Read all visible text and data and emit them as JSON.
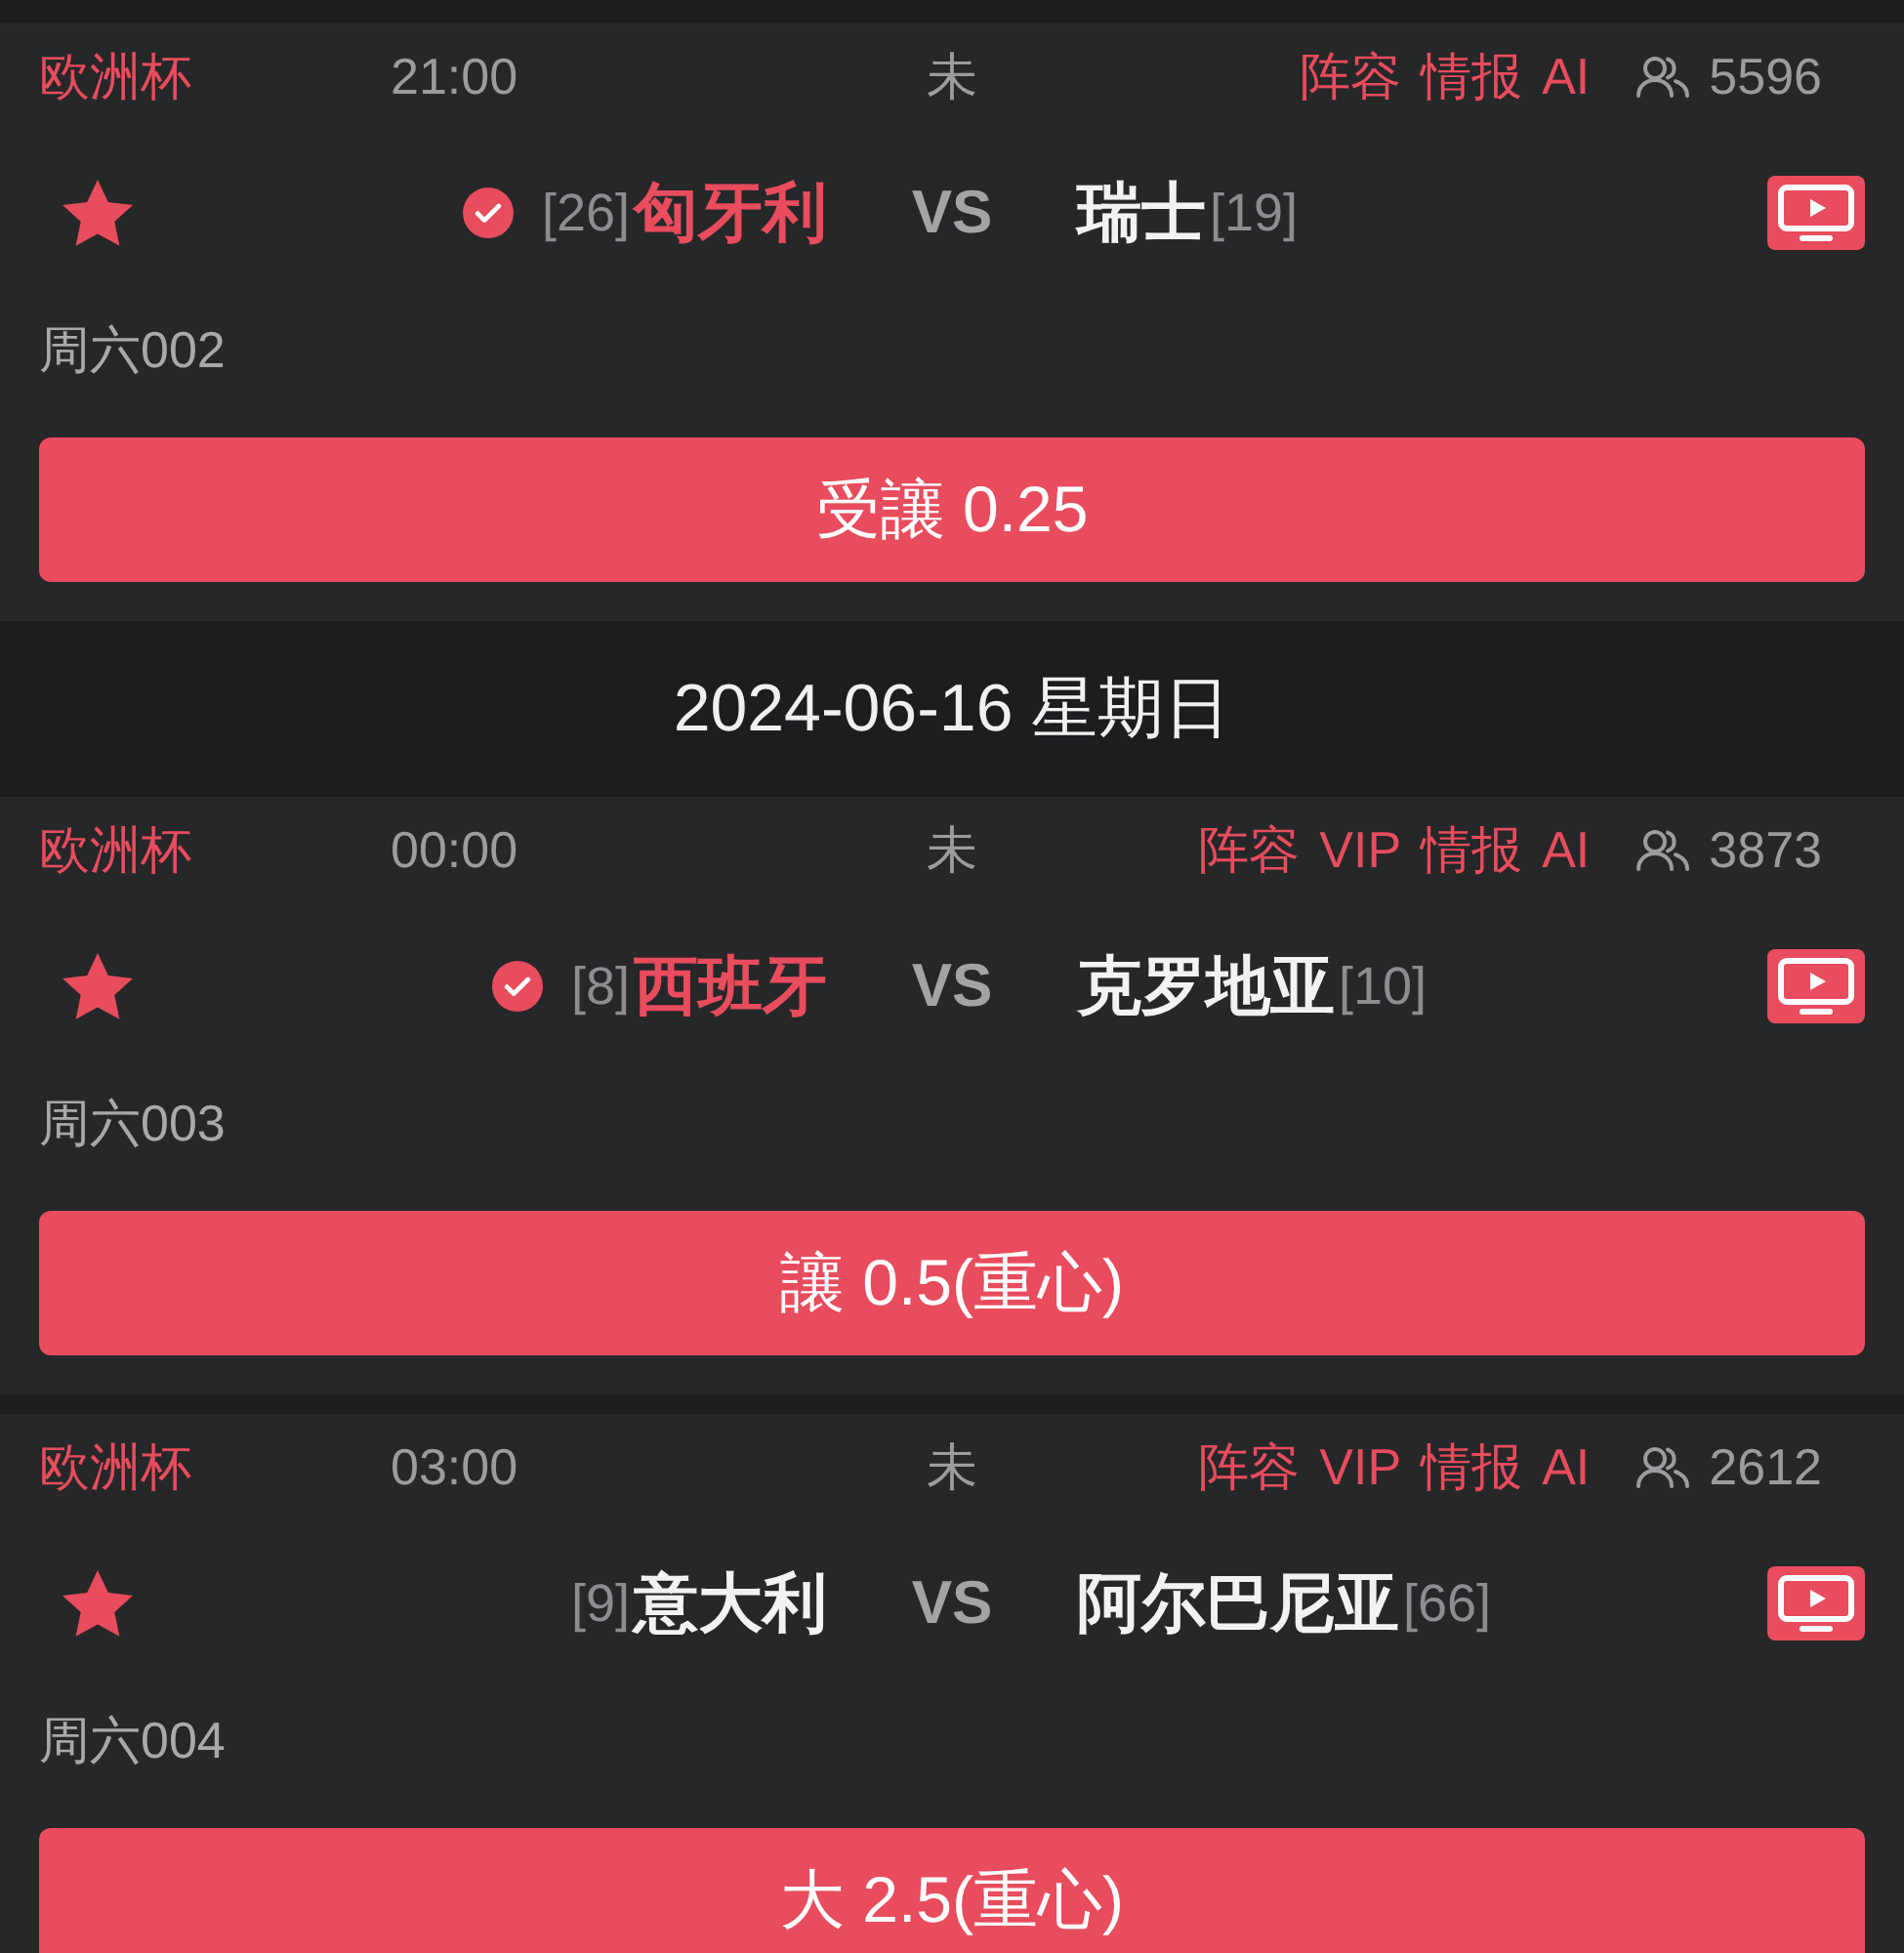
{
  "items": [
    {
      "kind": "match",
      "league": "欧洲杯",
      "time": "21:00",
      "status": "未",
      "tags": [
        "阵容",
        "情报",
        "AI"
      ],
      "viewers": "5596",
      "favorite": true,
      "home": {
        "rank": "[26]",
        "name": "匈牙利",
        "picked": true
      },
      "vs": "VS",
      "away": {
        "name": "瑞士",
        "rank": "[19]",
        "picked": false
      },
      "code": "周六002",
      "tip": "受讓 0.25"
    },
    {
      "kind": "date",
      "text": "2024-06-16 星期日"
    },
    {
      "kind": "match",
      "league": "欧洲杯",
      "time": "00:00",
      "status": "未",
      "tags": [
        "阵容",
        "VIP",
        "情报",
        "AI"
      ],
      "viewers": "3873",
      "favorite": true,
      "home": {
        "rank": "[8]",
        "name": "西班牙",
        "picked": true
      },
      "vs": "VS",
      "away": {
        "name": "克罗地亚",
        "rank": "[10]",
        "picked": false
      },
      "code": "周六003",
      "tip": "讓 0.5(重心)"
    },
    {
      "kind": "match",
      "league": "欧洲杯",
      "time": "03:00",
      "status": "未",
      "tags": [
        "阵容",
        "VIP",
        "情报",
        "AI"
      ],
      "viewers": "2612",
      "favorite": true,
      "home": {
        "rank": "[9]",
        "name": "意大利",
        "picked": false
      },
      "vs": "VS",
      "away": {
        "name": "阿尔巴尼亚",
        "rank": "[66]",
        "picked": false
      },
      "code": "周六004",
      "tip": "大 2.5(重心)"
    }
  ]
}
